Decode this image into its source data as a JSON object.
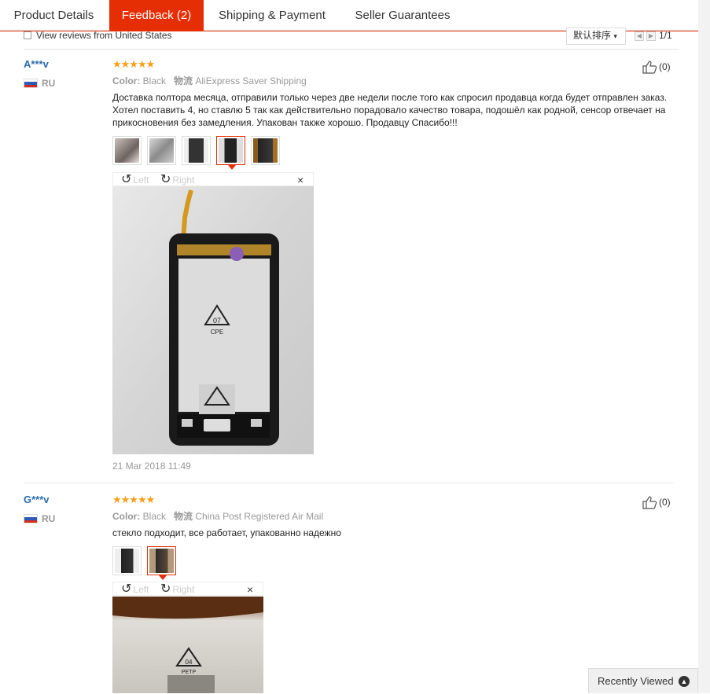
{
  "tabs": [
    {
      "label": "Product Details"
    },
    {
      "label": "Feedback (2)"
    },
    {
      "label": "Shipping & Payment"
    },
    {
      "label": "Seller Guarantees"
    }
  ],
  "filter": {
    "checkbox_label": "View reviews from United States",
    "sort_label": "默认排序",
    "page_text": "1/1"
  },
  "colors": {
    "accent": "#e62e04",
    "star": "#f6a01a",
    "username": "#2c6cb0"
  },
  "reviews": [
    {
      "user": "A***v",
      "country": "RU",
      "stars": "★★★★★",
      "color_label": "Color:",
      "color_value": "Black",
      "shipping_label": "物流",
      "shipping_value": "AliExpress Saver Shipping",
      "helpful": "(0)",
      "text": "Доставка полтора месяца, отправили только через две недели после того как спросил продавца когда будет отправлен заказ. Хотел поставить 4, но ставлю 5 так как действительно порадовало качество товара, подошёл как родной, сенсор отвечает на прикосновения без замедления. Упакован также хорошо. Продавцу Спасибо!!!",
      "rotate_left": "Left",
      "rotate_right": "Right",
      "close": "×",
      "photo_mark_1": "07",
      "photo_mark_2": "CPE",
      "date": "21 Mar 2018 11:49"
    },
    {
      "user": "G***v",
      "country": "RU",
      "stars": "★★★★★",
      "color_label": "Color:",
      "color_value": "Black",
      "shipping_label": "物流",
      "shipping_value": "China Post Registered Air Mail",
      "helpful": "(0)",
      "text": "стекло подходит, все работает, упакованно надежно",
      "rotate_left": "Left",
      "rotate_right": "Right",
      "close": "×",
      "photo_mark_1": "04",
      "photo_mark_2": "PETP"
    }
  ],
  "recently_viewed": "Recently Viewed",
  "icons": [
    "checkbox-icon",
    "chevron-down-icon",
    "prev-page-icon",
    "next-page-icon",
    "thumbs-up-icon",
    "rotate-left-icon",
    "rotate-right-icon",
    "close-icon",
    "chevron-up-icon"
  ]
}
